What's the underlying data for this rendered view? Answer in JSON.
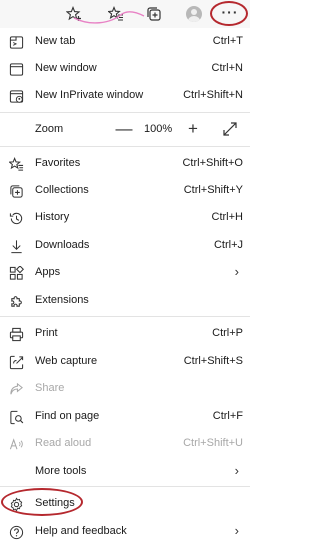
{
  "toolbar": {
    "icons": [
      "favorite-add-icon",
      "favorites-list-icon",
      "collections-icon",
      "profile-avatar-icon",
      "more-menu-icon"
    ],
    "more_label": "···",
    "annotation_color": "#b5282e"
  },
  "menu": {
    "new_tab": {
      "label": "New tab",
      "shortcut": "Ctrl+T"
    },
    "new_window": {
      "label": "New window",
      "shortcut": "Ctrl+N"
    },
    "new_inprivate": {
      "label": "New InPrivate window",
      "shortcut": "Ctrl+Shift+N"
    },
    "zoom": {
      "label": "Zoom",
      "minus": "—",
      "value": "100%",
      "plus": "+"
    },
    "favorites": {
      "label": "Favorites",
      "shortcut": "Ctrl+Shift+O"
    },
    "collections": {
      "label": "Collections",
      "shortcut": "Ctrl+Shift+Y"
    },
    "history": {
      "label": "History",
      "shortcut": "Ctrl+H"
    },
    "downloads": {
      "label": "Downloads",
      "shortcut": "Ctrl+J"
    },
    "apps": {
      "label": "Apps"
    },
    "extensions": {
      "label": "Extensions"
    },
    "print": {
      "label": "Print",
      "shortcut": "Ctrl+P"
    },
    "web_capture": {
      "label": "Web capture",
      "shortcut": "Ctrl+Shift+S"
    },
    "share": {
      "label": "Share"
    },
    "find_on_page": {
      "label": "Find on page",
      "shortcut": "Ctrl+F"
    },
    "read_aloud": {
      "label": "Read aloud",
      "shortcut": "Ctrl+Shift+U"
    },
    "more_tools": {
      "label": "More tools"
    },
    "settings": {
      "label": "Settings"
    },
    "help_feedback": {
      "label": "Help and feedback"
    },
    "submenu_arrow": "›",
    "disabled_color": "#a8a8a8"
  }
}
